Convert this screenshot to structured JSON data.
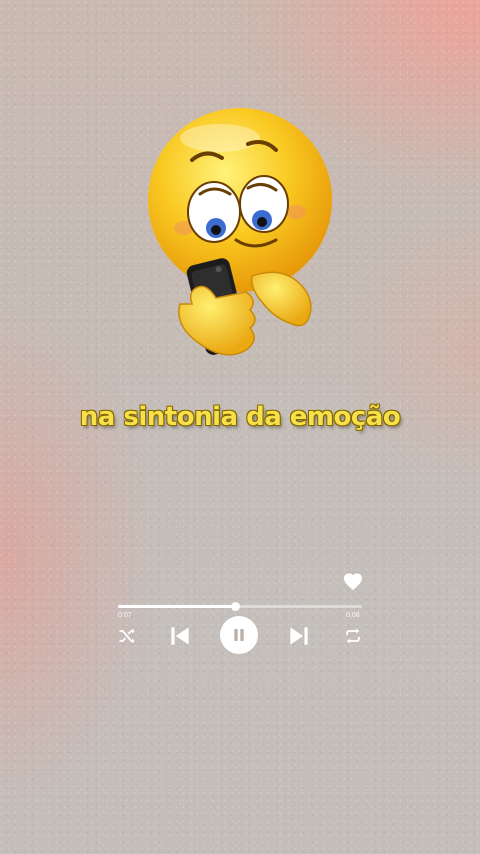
{
  "caption": "na sintonia da emoção",
  "player": {
    "elapsed": "0:07",
    "total": "0:08",
    "progress": 0.48,
    "liked": true
  },
  "icons": {
    "emoji": "emoji-looking-at-phone-icon",
    "heart": "heart-icon",
    "shuffle": "shuffle-icon",
    "previous": "skip-previous-icon",
    "pause": "pause-icon",
    "next": "skip-next-icon",
    "repeat": "repeat-icon"
  },
  "colors": {
    "caption": "#f7e04a",
    "controls": "#ffffff",
    "emoji_face": "#f9c820"
  }
}
